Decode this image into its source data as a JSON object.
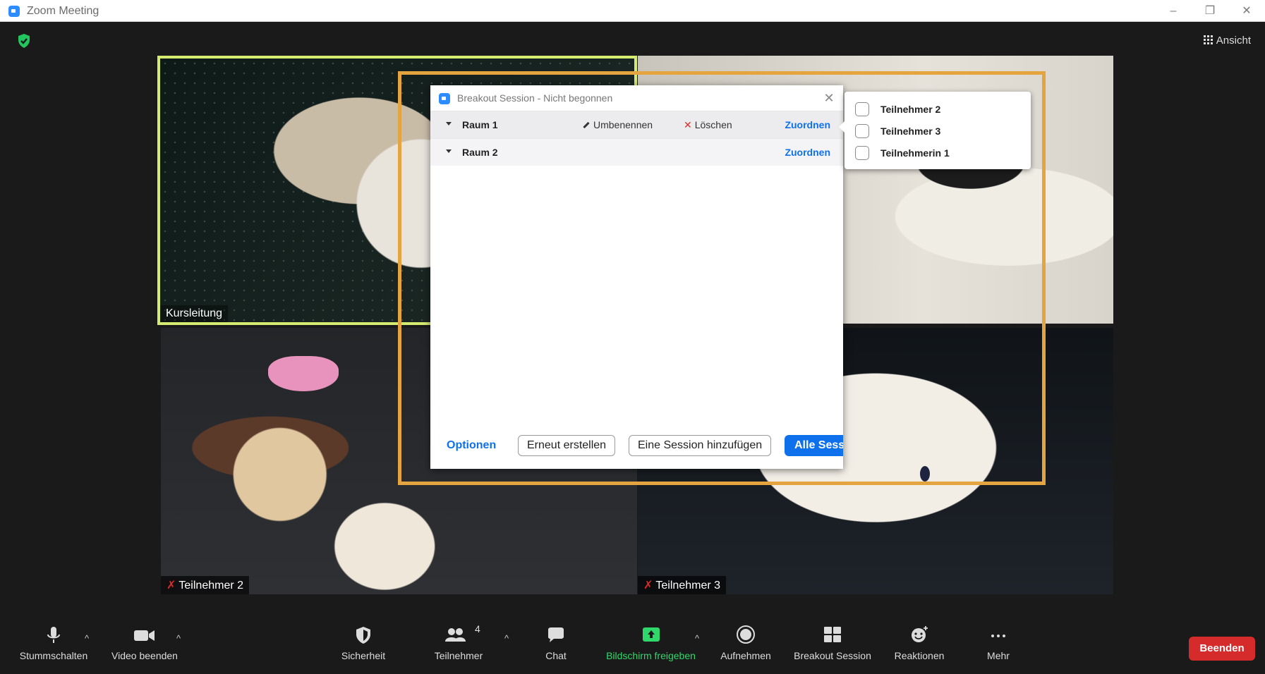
{
  "window": {
    "title": "Zoom Meeting",
    "controls": [
      "–",
      "❐",
      "✕"
    ]
  },
  "meeting": {
    "view_label": "Ansicht",
    "tiles": [
      {
        "name": "Kursleitung",
        "muted": false,
        "active_speaker": true
      },
      {
        "name": "",
        "muted": false
      },
      {
        "name": "Teilnehmer 2",
        "muted": true
      },
      {
        "name": "Teilnehmer 3",
        "muted": true
      }
    ]
  },
  "breakout": {
    "title": "Breakout Session - Nicht begonnen",
    "rooms": [
      {
        "name": "Raum 1",
        "rename": "Umbenennen",
        "delete": "Löschen",
        "assign": "Zuordnen"
      },
      {
        "name": "Raum 2",
        "assign": "Zuordnen"
      }
    ],
    "footer": {
      "options": "Optionen",
      "recreate": "Erneut erstellen",
      "add_session": "Eine Session hinzufügen",
      "start_all": "Alle Sess"
    }
  },
  "assign_popup": {
    "items": [
      "Teilnehmer 2",
      "Teilnehmer 3",
      "Teilnehmerin 1"
    ]
  },
  "toolbar": {
    "mute": "Stummschalten",
    "stop_video": "Video beenden",
    "security": "Sicherheit",
    "participants": "Teilnehmer",
    "participants_count": "4",
    "chat": "Chat",
    "share_screen": "Bildschirm freigeben",
    "record": "Aufnehmen",
    "breakout": "Breakout Session",
    "reactions": "Reaktionen",
    "more": "Mehr",
    "end": "Beenden"
  },
  "colors": {
    "accent": "#0e71eb",
    "highlight": "#e4a440",
    "active_speaker": "#d5ec70",
    "end_button": "#d52b2b",
    "share_green": "#2ed86b"
  }
}
